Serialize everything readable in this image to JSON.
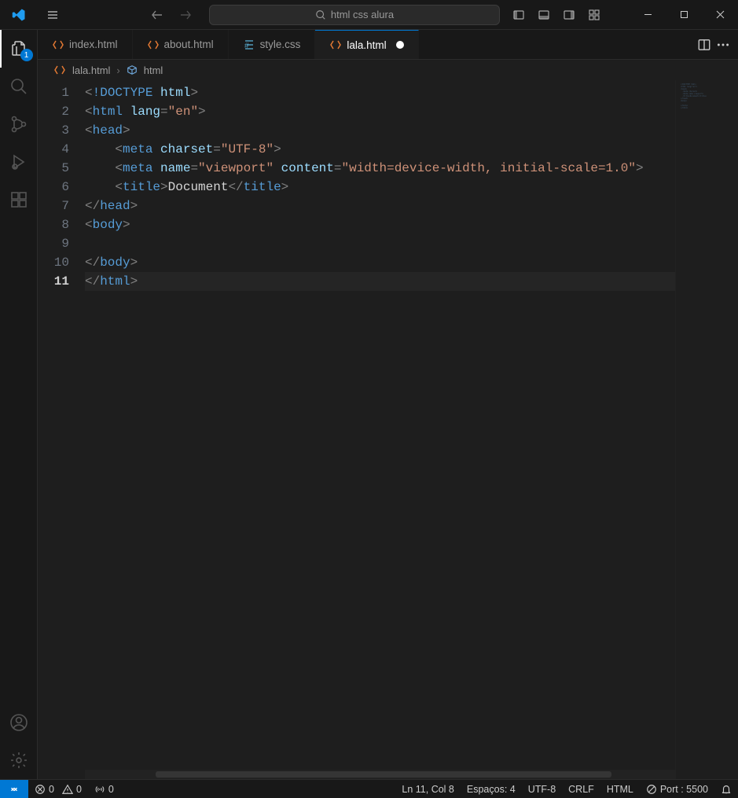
{
  "search": {
    "placeholder": "html css alura"
  },
  "activity_badge": "1",
  "tabs": [
    {
      "label": "index.html",
      "icon": "html",
      "active": false,
      "dirty": false
    },
    {
      "label": "about.html",
      "icon": "html",
      "active": false,
      "dirty": false
    },
    {
      "label": "style.css",
      "icon": "css",
      "active": false,
      "dirty": false
    },
    {
      "label": "lala.html",
      "icon": "html",
      "active": true,
      "dirty": true
    }
  ],
  "breadcrumb": {
    "file": "lala.html",
    "symbol": "html"
  },
  "code": {
    "active_line": 11,
    "lines": [
      {
        "n": 1,
        "tokens": [
          [
            "<",
            "punc"
          ],
          [
            "!DOCTYPE ",
            "doctype"
          ],
          [
            "html",
            "attr"
          ],
          [
            ">",
            "punc"
          ]
        ]
      },
      {
        "n": 2,
        "tokens": [
          [
            "<",
            "punc"
          ],
          [
            "html",
            "tag"
          ],
          [
            " lang",
            "attr"
          ],
          [
            "=",
            "punc"
          ],
          [
            "\"en\"",
            "str"
          ],
          [
            ">",
            "punc"
          ]
        ]
      },
      {
        "n": 3,
        "tokens": [
          [
            "<",
            "punc"
          ],
          [
            "head",
            "tag"
          ],
          [
            ">",
            "punc"
          ]
        ]
      },
      {
        "n": 4,
        "tokens": [
          [
            "    <",
            "punc"
          ],
          [
            "meta",
            "tag"
          ],
          [
            " charset",
            "attr"
          ],
          [
            "=",
            "punc"
          ],
          [
            "\"UTF-8\"",
            "str"
          ],
          [
            ">",
            "punc"
          ]
        ]
      },
      {
        "n": 5,
        "tokens": [
          [
            "    <",
            "punc"
          ],
          [
            "meta",
            "tag"
          ],
          [
            " name",
            "attr"
          ],
          [
            "=",
            "punc"
          ],
          [
            "\"viewport\"",
            "str"
          ],
          [
            " content",
            "attr"
          ],
          [
            "=",
            "punc"
          ],
          [
            "\"width=device-width, initial-scale=1.0\"",
            "str"
          ],
          [
            ">",
            "punc"
          ]
        ]
      },
      {
        "n": 6,
        "tokens": [
          [
            "    <",
            "punc"
          ],
          [
            "title",
            "tag"
          ],
          [
            ">",
            "punc"
          ],
          [
            "Document",
            "text"
          ],
          [
            "</",
            "punc"
          ],
          [
            "title",
            "tag"
          ],
          [
            ">",
            "punc"
          ]
        ]
      },
      {
        "n": 7,
        "tokens": [
          [
            "</",
            "punc"
          ],
          [
            "head",
            "tag"
          ],
          [
            ">",
            "punc"
          ]
        ]
      },
      {
        "n": 8,
        "tokens": [
          [
            "<",
            "punc"
          ],
          [
            "body",
            "tag"
          ],
          [
            ">",
            "punc"
          ]
        ]
      },
      {
        "n": 9,
        "tokens": []
      },
      {
        "n": 10,
        "tokens": [
          [
            "</",
            "punc"
          ],
          [
            "body",
            "tag"
          ],
          [
            ">",
            "punc"
          ]
        ]
      },
      {
        "n": 11,
        "tokens": [
          [
            "</",
            "punc"
          ],
          [
            "html",
            "tag"
          ],
          [
            ">",
            "punc"
          ]
        ]
      }
    ]
  },
  "statusbar": {
    "errors": "0",
    "warnings": "0",
    "radio": "0",
    "position": "Ln 11, Col 8",
    "spaces": "Espaços: 4",
    "encoding": "UTF-8",
    "eol": "CRLF",
    "lang": "HTML",
    "port": "Port : 5500"
  }
}
